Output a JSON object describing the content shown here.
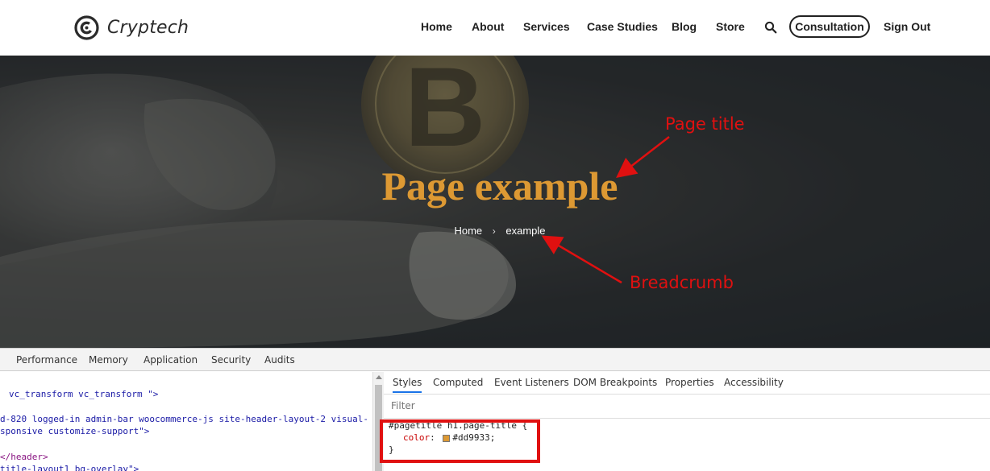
{
  "header": {
    "logo_text": "Cryptech",
    "nav": [
      "Home",
      "About",
      "Services",
      "Case Studies",
      "Blog",
      "Store"
    ],
    "search_icon": "search-icon",
    "consult_label": "Consultation",
    "signout_label": "Sign Out"
  },
  "hero": {
    "title": "Page example",
    "title_color": "#dd9933",
    "breadcrumb": {
      "home": "Home",
      "separator": "›",
      "current": "example"
    },
    "annotations": {
      "title": "Page title",
      "breadcrumb": "Breadcrumb"
    },
    "annotation_color": "#e01010"
  },
  "devtools": {
    "tabs": [
      "Performance",
      "Memory",
      "Application",
      "Security",
      "Audits"
    ],
    "elements_lines": [
      "vc_transform  vc_transform \">",
      "d-820 logged-in admin-bar woocommerce-js site-header-layout-2 visual-",
      "sponsive customize-support\">",
      "</header>",
      "title-layout1 bg-overlay\">"
    ],
    "styles_tabs": [
      "Styles",
      "Computed",
      "Event Listeners",
      "DOM Breakpoints",
      "Properties",
      "Accessibility"
    ],
    "filter_placeholder": "Filter",
    "rule": {
      "selector": "#pagetitle h1.page-title {",
      "property": "color",
      "value": "#dd9933;",
      "close": "}"
    }
  }
}
